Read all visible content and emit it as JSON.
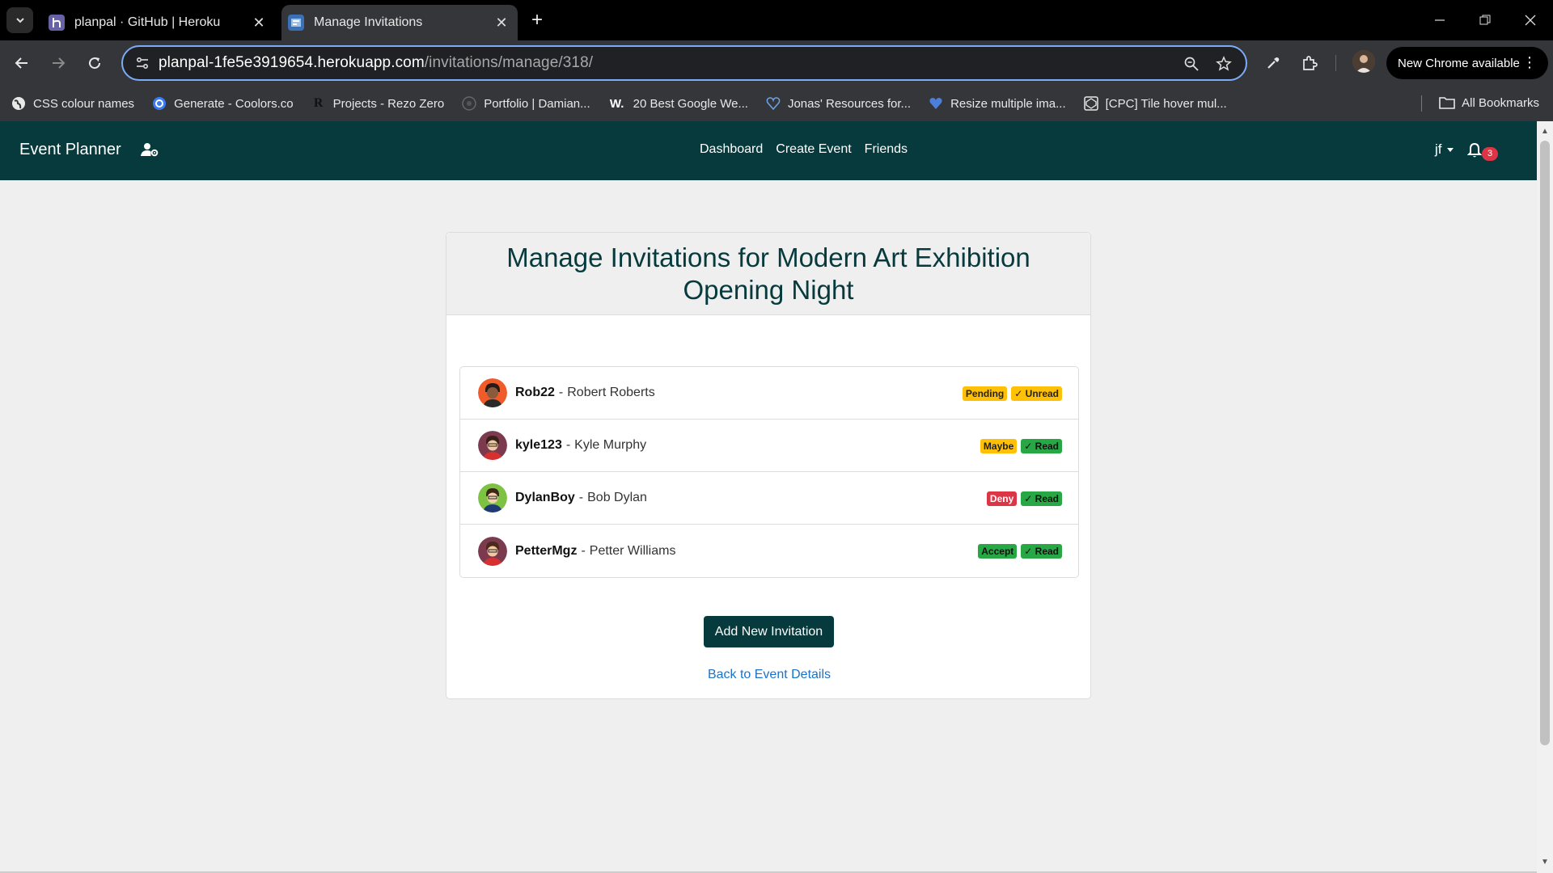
{
  "browser": {
    "tabs": [
      {
        "title": "planpal · GitHub | Heroku",
        "favicon_color": "#6762a6"
      },
      {
        "title": "Manage Invitations",
        "favicon_color": "#3b6fb6"
      }
    ],
    "new_tab_label": "+",
    "url_host": "planpal-1fe5e3919654.herokuapp.com",
    "url_path": "/invitations/manage/318/",
    "update_button": "New Chrome available",
    "bookmarks": [
      {
        "label": "CSS colour names",
        "icon": "globe-icon"
      },
      {
        "label": "Generate - Coolors.co",
        "icon": "coolors-icon"
      },
      {
        "label": "Projects - Rezo Zero",
        "icon": "R"
      },
      {
        "label": "Portfolio | Damian...",
        "icon": "portfolio-icon"
      },
      {
        "label": "20 Best Google We...",
        "icon": "W."
      },
      {
        "label": "Jonas' Resources for...",
        "icon": "heart-icon"
      },
      {
        "label": "Resize multiple ima...",
        "icon": "heart-icon"
      },
      {
        "label": "[CPC] Tile hover mul...",
        "icon": "codepen-icon"
      }
    ],
    "all_bookmarks": "All Bookmarks"
  },
  "app": {
    "brand": "Event Planner",
    "nav": [
      "Dashboard",
      "Create Event",
      "Friends"
    ],
    "user": "jf",
    "notification_count": "3",
    "nav_color": "#063a3d"
  },
  "page": {
    "title": "Manage Invitations for Modern Art Exhibition Opening Night",
    "invitations": [
      {
        "username": "Rob22",
        "sep": "-",
        "name": "Robert Roberts",
        "status": "Pending",
        "read": "✓ Unread"
      },
      {
        "username": "kyle123",
        "sep": "-",
        "name": "Kyle Murphy",
        "status": "Maybe",
        "read": "✓ Read"
      },
      {
        "username": "DylanBoy",
        "sep": "-",
        "name": "Bob Dylan",
        "status": "Deny",
        "read": "✓ Read"
      },
      {
        "username": "PetterMgz",
        "sep": "-",
        "name": "Petter Williams",
        "status": "Accept",
        "read": "✓ Read"
      }
    ],
    "add_button": "Add New Invitation",
    "back_link": "Back to Event Details"
  }
}
